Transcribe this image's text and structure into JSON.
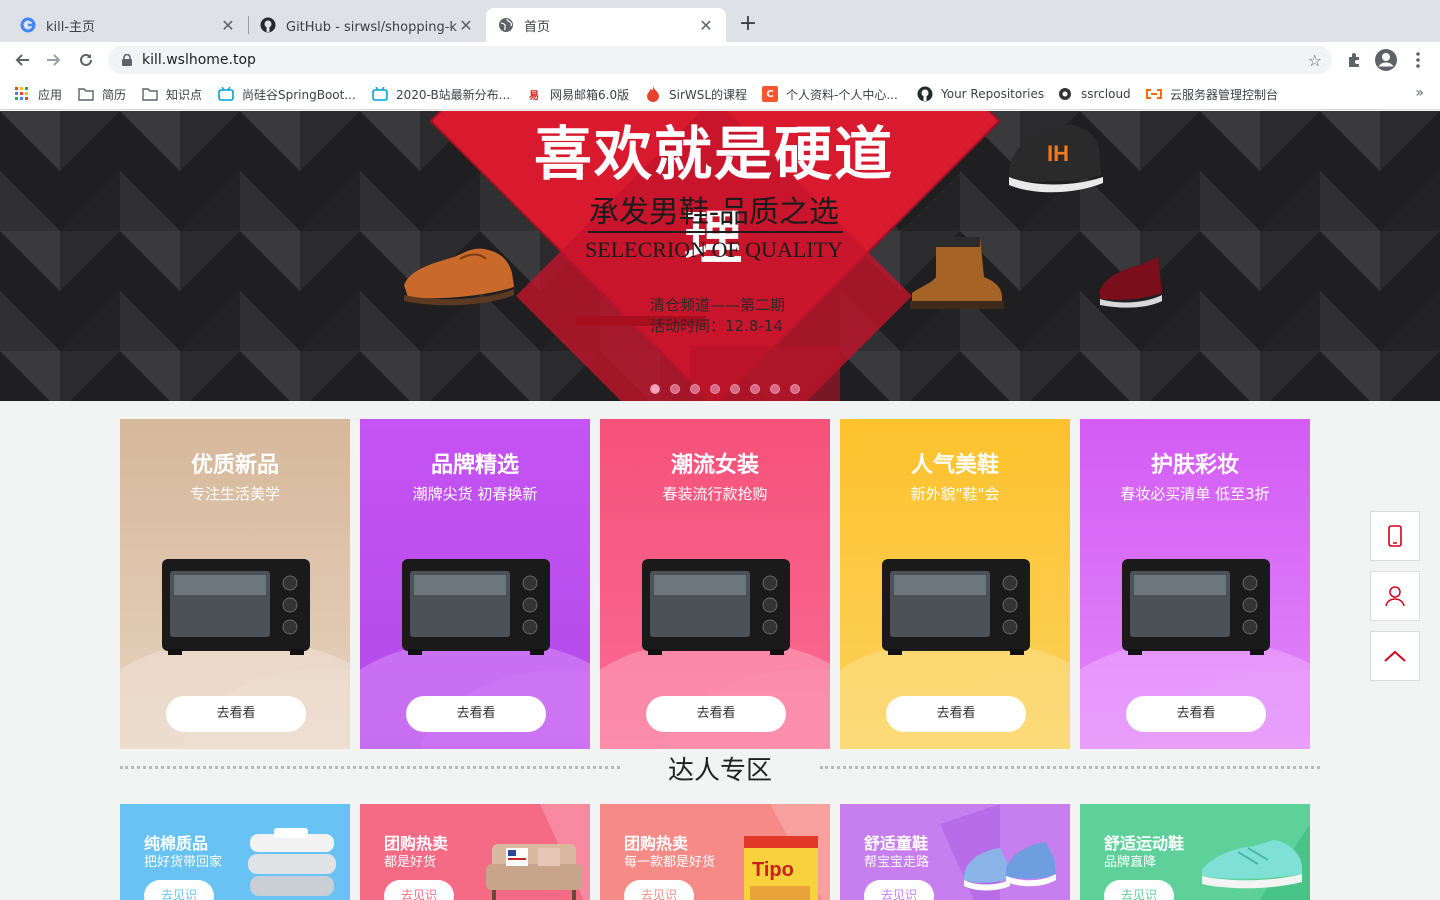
{
  "browser": {
    "tabs": [
      {
        "title": "kill-主页",
        "icon": "google-icon",
        "active": false
      },
      {
        "title": "GitHub - sirwsl/shopping-kill: 随",
        "icon": "github-icon",
        "active": false
      },
      {
        "title": "首页",
        "icon": "globe-icon",
        "active": true
      }
    ],
    "url": "kill.wslhome.top",
    "bookmarks": [
      {
        "label": "应用",
        "icon": "apps-grid-icon"
      },
      {
        "label": "简历",
        "icon": "folder-icon"
      },
      {
        "label": "知识点",
        "icon": "folder-icon"
      },
      {
        "label": "尚硅谷SpringBoot...",
        "icon": "bilibili-icon"
      },
      {
        "label": "2020-B站最新分布...",
        "icon": "bilibili-icon"
      },
      {
        "label": "网易邮箱6.0版",
        "icon": "netease-icon"
      },
      {
        "label": "SirWSL的课程",
        "icon": "flame-icon"
      },
      {
        "label": "个人资料-个人中心...",
        "icon": "csdn-icon"
      },
      {
        "label": "Your Repositories",
        "icon": "github-icon"
      },
      {
        "label": "ssrcloud",
        "icon": "ssrcloud-icon"
      },
      {
        "label": "云服务器管理控制台",
        "icon": "aliyun-icon"
      }
    ]
  },
  "banner": {
    "title": "喜欢就是硬道理",
    "subtitle": "承发男鞋-品质之选",
    "english": "SELECRION OF QUALITY",
    "info_line1": "清仓频道——第二期",
    "info_line2": "活动时间：12.8-14",
    "dot_count": 8,
    "active_dot": 0
  },
  "categories": [
    {
      "title": "优质新品",
      "subtitle": "专注生活美学",
      "button": "去看看",
      "color_top": "#d8bc9e",
      "color_bottom": "#ece0d4"
    },
    {
      "title": "品牌精选",
      "subtitle": "潮牌尖货 初春换新",
      "button": "去看看",
      "color_top": "#c653f4",
      "color_bottom": "#b24be8"
    },
    {
      "title": "潮流女装",
      "subtitle": "春装流行款抢购",
      "button": "去看看",
      "color_top": "#f6537a",
      "color_bottom": "#fb7ba2"
    },
    {
      "title": "人气美鞋",
      "subtitle": "新外貌\"鞋\"会",
      "button": "去看看",
      "color_top": "#fdc533",
      "color_bottom": "#fcd66a"
    },
    {
      "title": "护肤彩妆",
      "subtitle": "春妆必买清单 低至3折",
      "button": "去看看",
      "color_top": "#d65ff6",
      "color_bottom": "#e38ef9"
    }
  ],
  "section": {
    "title": "达人专区"
  },
  "tiles": [
    {
      "title": "纯棉质品",
      "subtitle": "把好货带回家",
      "button": "去见识",
      "bg": "#68c3f4",
      "btn_color": "#68c3f4"
    },
    {
      "title": "团购热卖",
      "subtitle": "都是好货",
      "button": "去见识",
      "bg": "#f56b85",
      "btn_color": "#f56b85"
    },
    {
      "title": "团购热卖",
      "subtitle": "每一款都是好货",
      "button": "去见识",
      "bg": "#f58a86",
      "btn_color": "#f58a86"
    },
    {
      "title": "舒适童鞋",
      "subtitle": "帮宝宝走路",
      "button": "去见识",
      "bg": "#c77ff0",
      "btn_color": "#c77ff0"
    },
    {
      "title": "舒适运动鞋",
      "subtitle": "品牌直降",
      "button": "去见识",
      "bg": "#5ed19a",
      "btn_color": "#5ed19a"
    }
  ],
  "side_toolbar": [
    {
      "name": "mobile-icon"
    },
    {
      "name": "user-icon"
    },
    {
      "name": "back-to-top-icon"
    }
  ]
}
